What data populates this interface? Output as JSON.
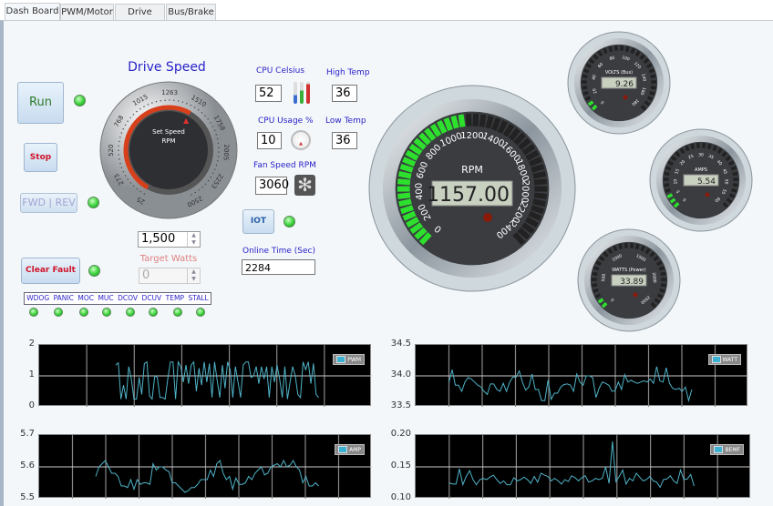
{
  "tabs": [
    "Dash Board",
    "PWM/Motor",
    "Drive",
    "Bus/Brake"
  ],
  "controls": {
    "run": "Run",
    "stop": "Stop",
    "fwd_rev": "FWD | REV",
    "clear_fault": "Clear Fault",
    "iot": "IOT"
  },
  "drive_speed": {
    "title": "Drive Speed",
    "knob_label1": "Set Speed",
    "knob_label2": "RPM",
    "scale": [
      "25",
      "273",
      "520",
      "768",
      "1015",
      "1263",
      "1510",
      "1758",
      "2005",
      "2253",
      "2500"
    ],
    "set_value": 1500,
    "spin_value": "1,500"
  },
  "target_watts": {
    "label": "Target Watts",
    "value": "0"
  },
  "faults": {
    "labels": [
      "WDOG",
      "PANIC",
      "MOC",
      "MUC",
      "DCOV",
      "DCUV",
      "TEMP",
      "STALL"
    ]
  },
  "cpu": {
    "celsius_label": "CPU Celsius",
    "celsius": "52",
    "usage_label": "CPU Usage %",
    "usage": "10",
    "high_label": "High Temp",
    "high": "36",
    "low_label": "Low Temp",
    "low": "36",
    "fan_label": "Fan Speed RPM",
    "fan": "3060"
  },
  "online": {
    "label": "Online Time (Sec)",
    "value": "2284"
  },
  "gauges": {
    "rpm": {
      "label": "RPM",
      "value": "1157.00",
      "num": 1157,
      "max": 2400,
      "ticks": [
        "0",
        "200",
        "400",
        "600",
        "800",
        "1000",
        "1200",
        "1400",
        "1600",
        "1800",
        "2000",
        "2200",
        "2400"
      ]
    },
    "volts": {
      "label": "VOLTS (Bus)",
      "value": "9.26",
      "num": 9.26,
      "max": 180,
      "ticks": [
        "0",
        "20",
        "40",
        "60",
        "80",
        "100",
        "120",
        "140",
        "160",
        "180"
      ]
    },
    "amps": {
      "label": "AMPS",
      "value": "5.54",
      "num": 5.54,
      "max": 60,
      "ticks": [
        "0",
        "5",
        "10",
        "15",
        "20",
        "25",
        "30",
        "35",
        "40",
        "45",
        "50",
        "55",
        "60"
      ]
    },
    "watts": {
      "label": "WATTS (Power)",
      "value": "33.89",
      "num": 33.89,
      "max": 2500,
      "ticks": [
        "0",
        "500",
        "1000",
        "1500",
        "2000",
        "2500"
      ]
    }
  },
  "chart_data": [
    {
      "type": "line",
      "name": "PWM",
      "ylim": [
        0,
        2
      ],
      "yticks": [
        "2",
        "1",
        "0"
      ],
      "x_range": [
        0.23,
        0.84
      ],
      "values": [
        1.35,
        1.42,
        0.25,
        0.7,
        0.25,
        1.3,
        0.9,
        0.25,
        0.25,
        0.95,
        0.4,
        1.4,
        1.45,
        0.35,
        0.25,
        1.0,
        0.95,
        0.3,
        0.3,
        0.25,
        0.9,
        1.45,
        1.45,
        0.25,
        1.45,
        1.3,
        0.8,
        1.35,
        0.75,
        1.35,
        1.45,
        0.5,
        1.25,
        0.7,
        1.45,
        0.8,
        1.4,
        0.3,
        1.45,
        0.85,
        0.3,
        1.35,
        0.6,
        1.45,
        1.2,
        0.3,
        1.3,
        0.8,
        0.3,
        1.35,
        1.45,
        1.45,
        0.95,
        1.0,
        1.3,
        0.75,
        1.3,
        0.9,
        1.3,
        0.3,
        1.3,
        0.8,
        1.35,
        0.9,
        0.3,
        1.3,
        0.25,
        0.8,
        1.3,
        1.0,
        0.4,
        0.3,
        1.45,
        1.2,
        1.45,
        0.75,
        1.4,
        0.4,
        0.3
      ]
    },
    {
      "type": "line",
      "name": "AMP",
      "ylim": [
        5.5,
        5.7
      ],
      "yticks": [
        "5.7",
        "5.6",
        "5.5"
      ],
      "x_range": [
        0.17,
        0.84
      ],
      "values": [
        5.57,
        5.6,
        5.61,
        5.62,
        5.6,
        5.58,
        5.58,
        5.57,
        5.54,
        5.54,
        5.535,
        5.56,
        5.53,
        5.56,
        5.545,
        5.55,
        5.55,
        5.545,
        5.61,
        5.59,
        5.6,
        5.6,
        5.59,
        5.585,
        5.55,
        5.55,
        5.54,
        5.53,
        5.52,
        5.525,
        5.535,
        5.535,
        5.545,
        5.56,
        5.56,
        5.56,
        5.59,
        5.57,
        5.61,
        5.62,
        5.58,
        5.56,
        5.57,
        5.53,
        5.565,
        5.545,
        5.545,
        5.55,
        5.57,
        5.56,
        5.58,
        5.59,
        5.6,
        5.575,
        5.58,
        5.6,
        5.605,
        5.61,
        5.6,
        5.62,
        5.6,
        5.605,
        5.62,
        5.6,
        5.59,
        5.55,
        5.57,
        5.54,
        5.54,
        5.55,
        5.54
      ]
    },
    {
      "type": "line",
      "name": "WATT",
      "ylim": [
        33.5,
        34.5
      ],
      "yticks": [
        "34.5",
        "34.0",
        "33.5"
      ],
      "x_range": [
        0.1,
        0.83
      ],
      "values": [
        33.9,
        34.1,
        33.85,
        33.85,
        33.75,
        33.9,
        33.97,
        33.95,
        33.9,
        33.85,
        33.82,
        33.75,
        33.7,
        33.87,
        33.87,
        33.78,
        33.75,
        33.88,
        33.75,
        33.9,
        33.98,
        33.98,
        34.08,
        33.9,
        33.77,
        33.82,
        34.03,
        33.78,
        33.78,
        33.6,
        33.6,
        33.93,
        33.62,
        33.72,
        33.72,
        33.82,
        33.86,
        33.87,
        33.85,
        33.75,
        34.03,
        33.9,
        33.85,
        34.0,
        34.0,
        33.97,
        33.65,
        33.8,
        33.9,
        33.88,
        33.85,
        33.75,
        33.76,
        33.9,
        33.78,
        34.02,
        33.9,
        33.93,
        33.9,
        33.88,
        33.9,
        33.92,
        33.9,
        33.95,
        33.88,
        34.15,
        33.92,
        33.9,
        34.13,
        33.88,
        33.8,
        33.78,
        33.8,
        33.75,
        33.82,
        33.6,
        33.78
      ]
    },
    {
      "type": "line",
      "name": "BEMF",
      "ylim": [
        0.1,
        0.2
      ],
      "yticks": [
        "0.20",
        "0.15",
        "0.10"
      ],
      "x_range": [
        0.1,
        0.83
      ],
      "values": [
        0.125,
        0.123,
        0.123,
        0.147,
        0.122,
        0.135,
        0.144,
        0.13,
        0.122,
        0.13,
        0.132,
        0.13,
        0.134,
        0.137,
        0.13,
        0.124,
        0.128,
        0.122,
        0.122,
        0.133,
        0.128,
        0.13,
        0.134,
        0.13,
        0.124,
        0.135,
        0.126,
        0.14,
        0.137,
        0.135,
        0.128,
        0.132,
        0.128,
        0.123,
        0.13,
        0.127,
        0.136,
        0.133,
        0.128,
        0.133,
        0.136,
        0.126,
        0.128,
        0.132,
        0.13,
        0.132,
        0.15,
        0.124,
        0.19,
        0.127,
        0.135,
        0.145,
        0.123,
        0.132,
        0.128,
        0.14,
        0.134,
        0.128,
        0.13,
        0.135,
        0.128,
        0.126,
        0.118,
        0.13,
        0.131,
        0.136,
        0.128,
        0.124,
        0.145,
        0.13,
        0.131,
        0.138,
        0.12
      ]
    }
  ],
  "colors": {
    "line": "#4fb3c8",
    "led": "#3ad23a",
    "title": "#2a22c8",
    "fault_red": "#d0142a"
  }
}
